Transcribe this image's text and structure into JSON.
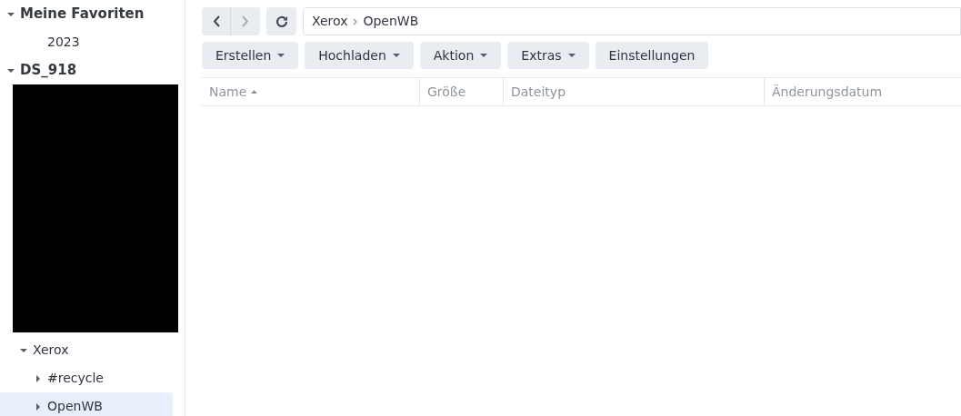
{
  "sidebar": {
    "tree": [
      {
        "kind": "folder",
        "label": "Meine Favoriten",
        "expanded": true,
        "selected": false,
        "children": [
          {
            "kind": "folder",
            "label": "2023",
            "selected": false
          }
        ]
      },
      {
        "kind": "folder",
        "label": "DS_918",
        "expanded": true,
        "selected": false,
        "children": [
          {
            "kind": "redacted"
          },
          {
            "kind": "folder",
            "label": "Xerox",
            "expanded": true,
            "selected": false,
            "children": [
              {
                "kind": "folder",
                "label": "#recycle",
                "expanded": false,
                "selected": false
              },
              {
                "kind": "folder",
                "label": "OpenWB",
                "expanded": false,
                "selected": true
              }
            ]
          }
        ]
      }
    ]
  },
  "path": [
    "Xerox",
    "OpenWB"
  ],
  "toolbar": [
    {
      "label": "Erstellen",
      "dropdown": true
    },
    {
      "label": "Hochladen",
      "dropdown": true
    },
    {
      "label": "Aktion",
      "dropdown": true
    },
    {
      "label": "Extras",
      "dropdown": true
    },
    {
      "label": "Einstellungen",
      "dropdown": false
    }
  ],
  "table": {
    "columns": [
      {
        "label": "Name",
        "sorted": true
      },
      {
        "label": "Größe",
        "sorted": false
      },
      {
        "label": "Dateityp",
        "sorted": false
      },
      {
        "label": "Änderungsdatum",
        "sorted": false
      }
    ]
  }
}
